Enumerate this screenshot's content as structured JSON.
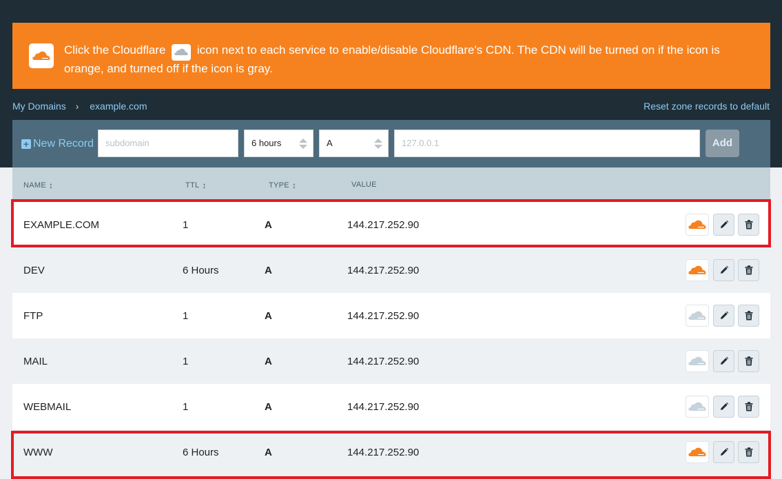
{
  "banner": {
    "text_before": "Click the Cloudflare",
    "text_after": "icon next to each service to enable/disable Cloudflare's CDN. The CDN will be turned on if the icon is orange, and turned off if the icon is gray.",
    "icon": "cloud-icon"
  },
  "breadcrumb": {
    "root": "My Domains",
    "separator": "›",
    "current": "example.com"
  },
  "reset_link": "Reset zone records to default",
  "new_record": {
    "label": "New Record",
    "subdomain_placeholder": "subdomain",
    "ttl_value": "6 hours",
    "type_value": "A",
    "value_placeholder": "127.0.0.1",
    "add_label": "Add"
  },
  "columns": {
    "name": "NAME",
    "ttl": "TTL",
    "type": "TYPE",
    "value": "VALUE"
  },
  "records": [
    {
      "name": "EXAMPLE.COM",
      "ttl": "1",
      "type": "A",
      "value": "144.217.252.90",
      "cdn": "on"
    },
    {
      "name": "DEV",
      "ttl": "6 Hours",
      "type": "A",
      "value": "144.217.252.90",
      "cdn": "on"
    },
    {
      "name": "FTP",
      "ttl": "1",
      "type": "A",
      "value": "144.217.252.90",
      "cdn": "off"
    },
    {
      "name": "MAIL",
      "ttl": "1",
      "type": "A",
      "value": "144.217.252.90",
      "cdn": "off"
    },
    {
      "name": "WEBMAIL",
      "ttl": "1",
      "type": "A",
      "value": "144.217.252.90",
      "cdn": "off"
    },
    {
      "name": "WWW",
      "ttl": "6 Hours",
      "type": "A",
      "value": "144.217.252.90",
      "cdn": "on"
    }
  ],
  "colors": {
    "cdn_on": "#f6821f",
    "cdn_off": "#c7d3db",
    "highlight": "#e31b23",
    "banner": "#f6821f"
  }
}
